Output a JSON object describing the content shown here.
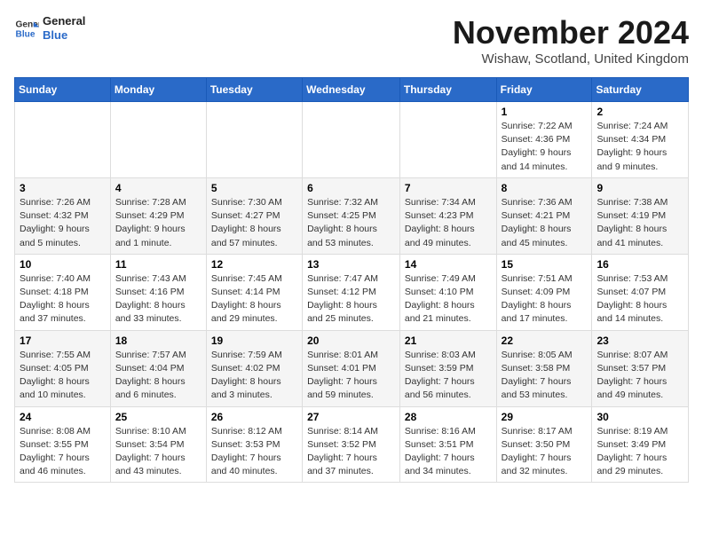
{
  "logo": {
    "line1": "General",
    "line2": "Blue"
  },
  "title": "November 2024",
  "location": "Wishaw, Scotland, United Kingdom",
  "weekdays": [
    "Sunday",
    "Monday",
    "Tuesday",
    "Wednesday",
    "Thursday",
    "Friday",
    "Saturday"
  ],
  "weeks": [
    [
      {
        "day": "",
        "info": ""
      },
      {
        "day": "",
        "info": ""
      },
      {
        "day": "",
        "info": ""
      },
      {
        "day": "",
        "info": ""
      },
      {
        "day": "",
        "info": ""
      },
      {
        "day": "1",
        "info": "Sunrise: 7:22 AM\nSunset: 4:36 PM\nDaylight: 9 hours and 14 minutes."
      },
      {
        "day": "2",
        "info": "Sunrise: 7:24 AM\nSunset: 4:34 PM\nDaylight: 9 hours and 9 minutes."
      }
    ],
    [
      {
        "day": "3",
        "info": "Sunrise: 7:26 AM\nSunset: 4:32 PM\nDaylight: 9 hours and 5 minutes."
      },
      {
        "day": "4",
        "info": "Sunrise: 7:28 AM\nSunset: 4:29 PM\nDaylight: 9 hours and 1 minute."
      },
      {
        "day": "5",
        "info": "Sunrise: 7:30 AM\nSunset: 4:27 PM\nDaylight: 8 hours and 57 minutes."
      },
      {
        "day": "6",
        "info": "Sunrise: 7:32 AM\nSunset: 4:25 PM\nDaylight: 8 hours and 53 minutes."
      },
      {
        "day": "7",
        "info": "Sunrise: 7:34 AM\nSunset: 4:23 PM\nDaylight: 8 hours and 49 minutes."
      },
      {
        "day": "8",
        "info": "Sunrise: 7:36 AM\nSunset: 4:21 PM\nDaylight: 8 hours and 45 minutes."
      },
      {
        "day": "9",
        "info": "Sunrise: 7:38 AM\nSunset: 4:19 PM\nDaylight: 8 hours and 41 minutes."
      }
    ],
    [
      {
        "day": "10",
        "info": "Sunrise: 7:40 AM\nSunset: 4:18 PM\nDaylight: 8 hours and 37 minutes."
      },
      {
        "day": "11",
        "info": "Sunrise: 7:43 AM\nSunset: 4:16 PM\nDaylight: 8 hours and 33 minutes."
      },
      {
        "day": "12",
        "info": "Sunrise: 7:45 AM\nSunset: 4:14 PM\nDaylight: 8 hours and 29 minutes."
      },
      {
        "day": "13",
        "info": "Sunrise: 7:47 AM\nSunset: 4:12 PM\nDaylight: 8 hours and 25 minutes."
      },
      {
        "day": "14",
        "info": "Sunrise: 7:49 AM\nSunset: 4:10 PM\nDaylight: 8 hours and 21 minutes."
      },
      {
        "day": "15",
        "info": "Sunrise: 7:51 AM\nSunset: 4:09 PM\nDaylight: 8 hours and 17 minutes."
      },
      {
        "day": "16",
        "info": "Sunrise: 7:53 AM\nSunset: 4:07 PM\nDaylight: 8 hours and 14 minutes."
      }
    ],
    [
      {
        "day": "17",
        "info": "Sunrise: 7:55 AM\nSunset: 4:05 PM\nDaylight: 8 hours and 10 minutes."
      },
      {
        "day": "18",
        "info": "Sunrise: 7:57 AM\nSunset: 4:04 PM\nDaylight: 8 hours and 6 minutes."
      },
      {
        "day": "19",
        "info": "Sunrise: 7:59 AM\nSunset: 4:02 PM\nDaylight: 8 hours and 3 minutes."
      },
      {
        "day": "20",
        "info": "Sunrise: 8:01 AM\nSunset: 4:01 PM\nDaylight: 7 hours and 59 minutes."
      },
      {
        "day": "21",
        "info": "Sunrise: 8:03 AM\nSunset: 3:59 PM\nDaylight: 7 hours and 56 minutes."
      },
      {
        "day": "22",
        "info": "Sunrise: 8:05 AM\nSunset: 3:58 PM\nDaylight: 7 hours and 53 minutes."
      },
      {
        "day": "23",
        "info": "Sunrise: 8:07 AM\nSunset: 3:57 PM\nDaylight: 7 hours and 49 minutes."
      }
    ],
    [
      {
        "day": "24",
        "info": "Sunrise: 8:08 AM\nSunset: 3:55 PM\nDaylight: 7 hours and 46 minutes."
      },
      {
        "day": "25",
        "info": "Sunrise: 8:10 AM\nSunset: 3:54 PM\nDaylight: 7 hours and 43 minutes."
      },
      {
        "day": "26",
        "info": "Sunrise: 8:12 AM\nSunset: 3:53 PM\nDaylight: 7 hours and 40 minutes."
      },
      {
        "day": "27",
        "info": "Sunrise: 8:14 AM\nSunset: 3:52 PM\nDaylight: 7 hours and 37 minutes."
      },
      {
        "day": "28",
        "info": "Sunrise: 8:16 AM\nSunset: 3:51 PM\nDaylight: 7 hours and 34 minutes."
      },
      {
        "day": "29",
        "info": "Sunrise: 8:17 AM\nSunset: 3:50 PM\nDaylight: 7 hours and 32 minutes."
      },
      {
        "day": "30",
        "info": "Sunrise: 8:19 AM\nSunset: 3:49 PM\nDaylight: 7 hours and 29 minutes."
      }
    ]
  ]
}
